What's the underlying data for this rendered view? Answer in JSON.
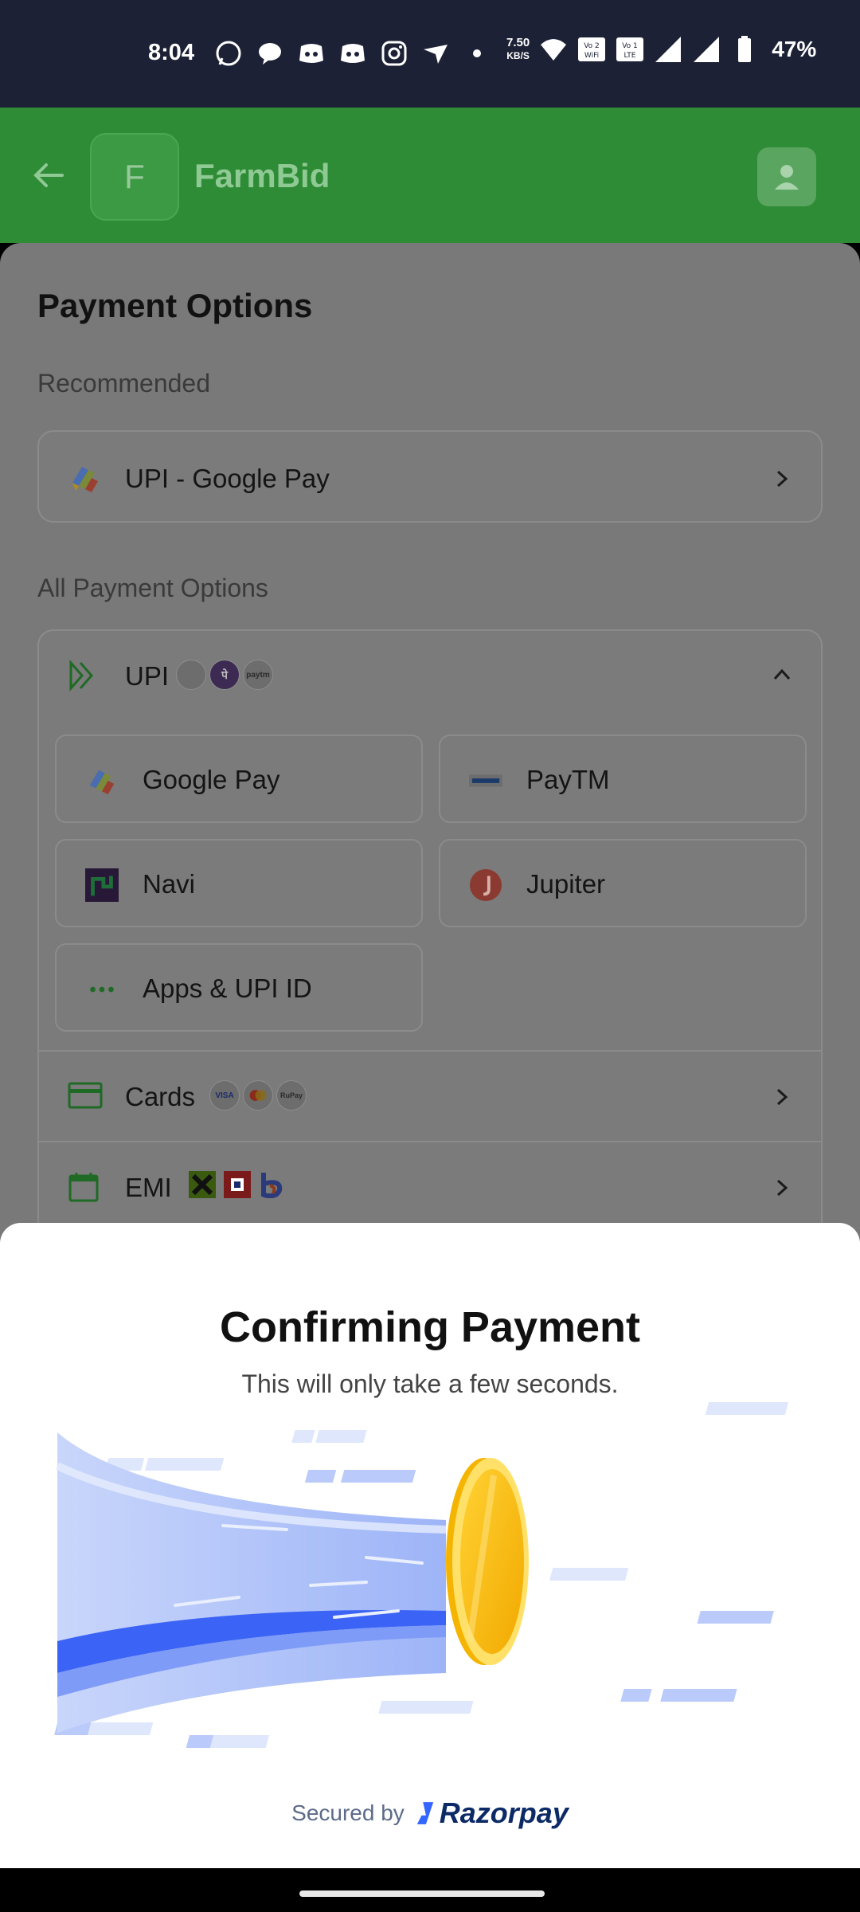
{
  "status_bar": {
    "time": "8:04",
    "net_speed_value": "7.50",
    "net_speed_unit": "KB/S",
    "wifi_badge": "Vo 2 WiFi",
    "lte_badge": "Vo 1 LTE",
    "battery": "47%",
    "notification_icons": [
      "whatsapp-icon",
      "chat-icon",
      "discord-icon",
      "discord-icon",
      "instagram-icon",
      "send-icon",
      "dot-icon"
    ]
  },
  "header": {
    "logo_letter": "F",
    "app_name": "FarmBid"
  },
  "payment": {
    "title": "Payment Options",
    "recommended_label": "Recommended",
    "recommended_item": "UPI - Google Pay",
    "all_label": "All Payment Options",
    "upi_label": "UPI",
    "upi_apps": [
      {
        "label": "Google Pay",
        "icon": "google-pay-icon"
      },
      {
        "label": "PayTM",
        "icon": "paytm-icon"
      },
      {
        "label": "Navi",
        "icon": "navi-icon"
      },
      {
        "label": "Jupiter",
        "icon": "jupiter-icon"
      },
      {
        "label": "Apps & UPI ID",
        "icon": "more-dots-icon"
      }
    ],
    "cards_label": "Cards",
    "emi_label": "EMI",
    "upi_mini_logos": [
      "",
      "पे",
      "paytm"
    ],
    "card_mini_logos": [
      "VISA",
      "",
      "RuPay"
    ]
  },
  "modal": {
    "title": "Confirming Payment",
    "subtitle": "This will only take a few seconds.",
    "secured_by": "Secured by",
    "brand": "Razorpay"
  },
  "colors": {
    "header_green": "#2f8c36",
    "razorpay_navy": "#0b2a66",
    "accent_blue": "#3366ff",
    "coin_gold": "#ffc700"
  }
}
